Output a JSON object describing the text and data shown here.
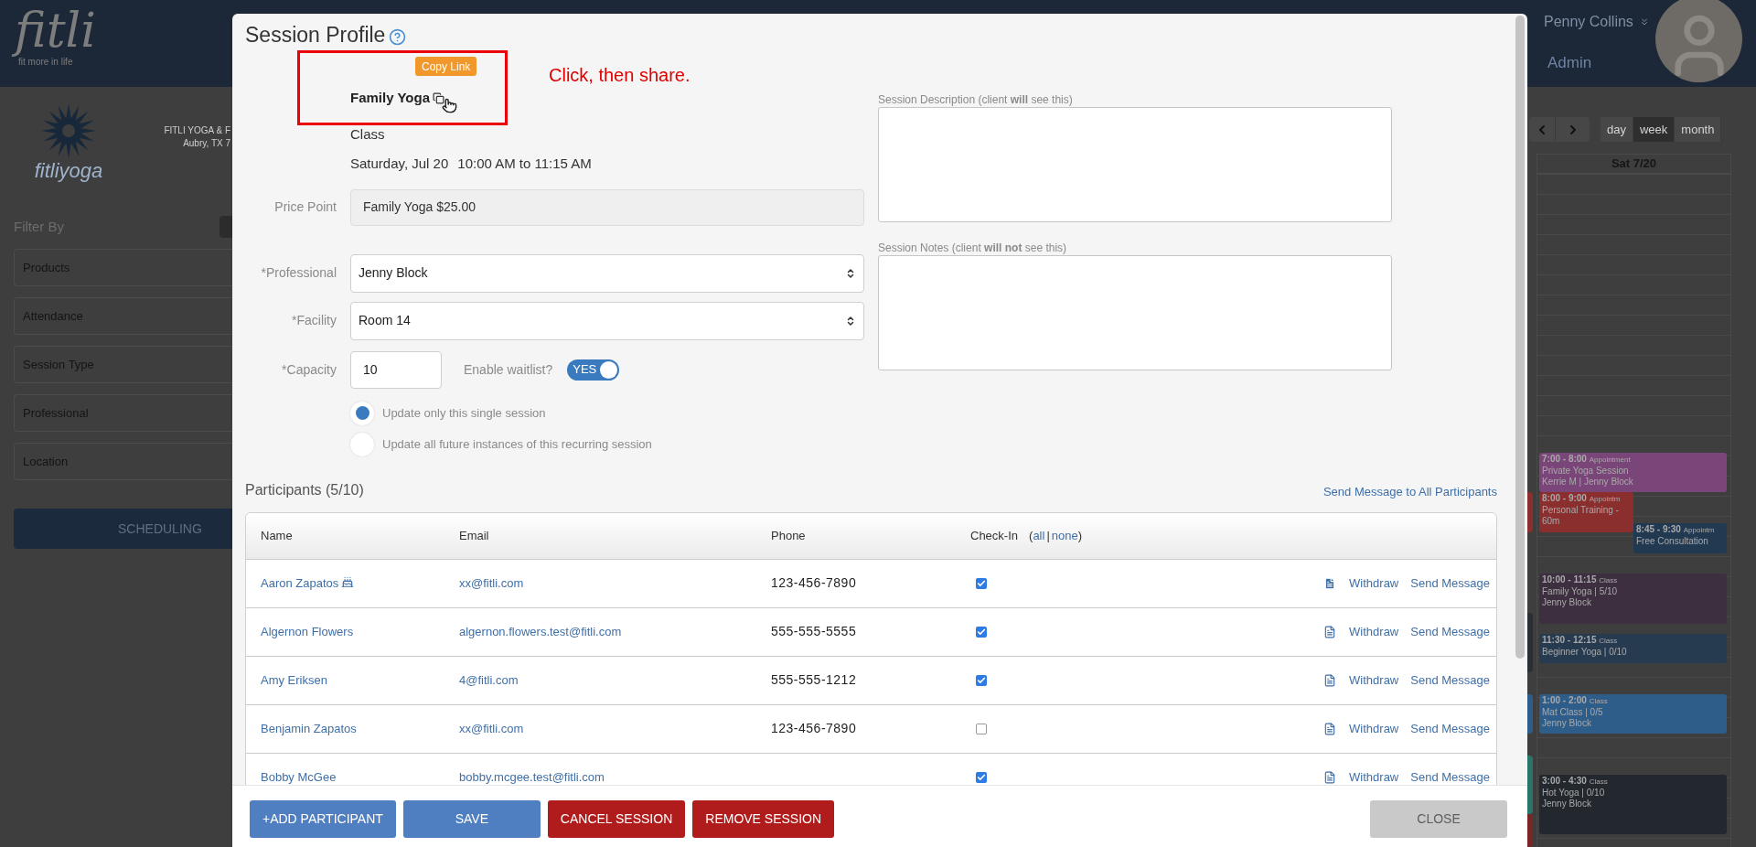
{
  "app_header": {
    "logo": "fitli",
    "tagline": "fit more in life",
    "user_name": "Penny Collins",
    "role": "Admin"
  },
  "sidebar": {
    "brand": "fitliyoga",
    "studio_name": "FITLI YOGA & F",
    "studio_address": "Aubry, TX 7",
    "filter_title": "Filter By",
    "filters": [
      "Products",
      "Attendance",
      "Session Type",
      "Professional",
      "Location"
    ],
    "scheduling_button": "SCHEDULING"
  },
  "calendar": {
    "views": [
      {
        "label": "day",
        "selected": false
      },
      {
        "label": "week",
        "selected": true
      },
      {
        "label": "month",
        "selected": false
      }
    ],
    "day_header": "Sat 7/20",
    "events": [
      {
        "time": "7:00 - 8:00",
        "type": "Appointment",
        "title": "Private Yoga Session",
        "detail": "Kerrie M | Jenny Block",
        "color": "#7a4679"
      },
      {
        "time": "8:00 - 9:00",
        "type": "Appointm",
        "title": "Personal Training -",
        "detail": "60m",
        "color": "#8a2e2e"
      },
      {
        "time": "8:45 - 9:30",
        "type": "Appointm",
        "title": "Free Consultation",
        "color": "#213a52"
      },
      {
        "time": "10:00 - 11:15",
        "type": "Class",
        "title": "Family Yoga | 5/10",
        "detail": "Jenny Block",
        "color": "#3d2f40"
      },
      {
        "time": "11:30 - 12:15",
        "type": "Class",
        "title": "Beginner Yoga | 0/10",
        "color": "#263a50"
      },
      {
        "time": "1:00 - 2:00",
        "type": "Class",
        "title": "Mat Class | 0/5",
        "detail": "Jenny Block",
        "color": "#2f5d8a"
      },
      {
        "time": "3:00 - 4:30",
        "type": "Class",
        "title": "Hot Yoga | 0/10",
        "detail": "Jenny Block",
        "color": "#23272e"
      }
    ],
    "side_events": [
      {
        "color": "#8a2e2e"
      },
      {
        "color": "#2a2f37"
      },
      {
        "color": "#2f5d8a"
      },
      {
        "color": "#2a7569"
      },
      {
        "color": "#7a2626"
      }
    ]
  },
  "modal": {
    "title": "Session Profile",
    "copy_tooltip": "Copy Link",
    "session_name": "Family Yoga",
    "annotation": "Click, then share.",
    "session_type": "Class",
    "date": "Saturday, Jul 20",
    "time": "10:00 AM to 11:15 AM",
    "price_point": {
      "label": "Price Point",
      "value": "Family Yoga $25.00"
    },
    "professional": {
      "label": "*Professional",
      "value": "Jenny Block"
    },
    "facility": {
      "label": "*Facility",
      "value": "Room 14"
    },
    "capacity": {
      "label": "*Capacity",
      "value": "10"
    },
    "waitlist": {
      "label": "Enable waitlist?",
      "on": true,
      "text": "YES"
    },
    "update_scope": [
      {
        "label": "Update only this single session",
        "selected": true
      },
      {
        "label": "Update all future instances of this recurring session",
        "selected": false
      }
    ],
    "description": {
      "label": "Session Description (client **will** see this)"
    },
    "notes": {
      "label": "Session Notes (client **will not** see this)"
    },
    "participants": {
      "title": "Participants (5/10)",
      "send_all": "Send Message to All Participants",
      "columns": [
        "Name",
        "Email",
        "Phone",
        "Check-In"
      ],
      "checkin_open": "(",
      "checkin_all": "all",
      "checkin_sep": "|",
      "checkin_none": "none",
      "checkin_close": ")",
      "rows": [
        {
          "name": "Aaron Zapatos",
          "birthday": true,
          "email": "xx@fitli.com",
          "phone": "123-456-7890",
          "checked": true,
          "document_filled": true,
          "withdraw": "Withdraw",
          "send_message": "Send Message"
        },
        {
          "name": "Algernon Flowers",
          "birthday": false,
          "email": "algernon.flowers.test@fitli.com",
          "phone": "555-555-5555",
          "checked": true,
          "document_filled": false,
          "withdraw": "Withdraw",
          "send_message": "Send Message"
        },
        {
          "name": "Amy Eriksen",
          "birthday": false,
          "email": "4@fitli.com",
          "phone": "555-555-1212",
          "checked": true,
          "document_filled": false,
          "withdraw": "Withdraw",
          "send_message": "Send Message"
        },
        {
          "name": "Benjamin Zapatos",
          "birthday": false,
          "email": "xx@fitli.com",
          "phone": "123-456-7890",
          "checked": false,
          "document_filled": false,
          "withdraw": "Withdraw",
          "send_message": "Send Message"
        },
        {
          "name": "Bobby McGee",
          "birthday": false,
          "email": "bobby.mcgee.test@fitli.com",
          "checked": true,
          "document_filled": false,
          "withdraw": "Withdraw",
          "send_message": "Send Message"
        }
      ]
    },
    "buttons": [
      {
        "label": "+ADD PARTICIPANT",
        "kind": "primary"
      },
      {
        "label": "SAVE",
        "kind": "primary"
      },
      {
        "label": "CANCEL SESSION",
        "kind": "danger"
      },
      {
        "label": "REMOVE SESSION",
        "kind": "danger"
      },
      {
        "label": "CLOSE",
        "kind": "disabled"
      }
    ]
  }
}
